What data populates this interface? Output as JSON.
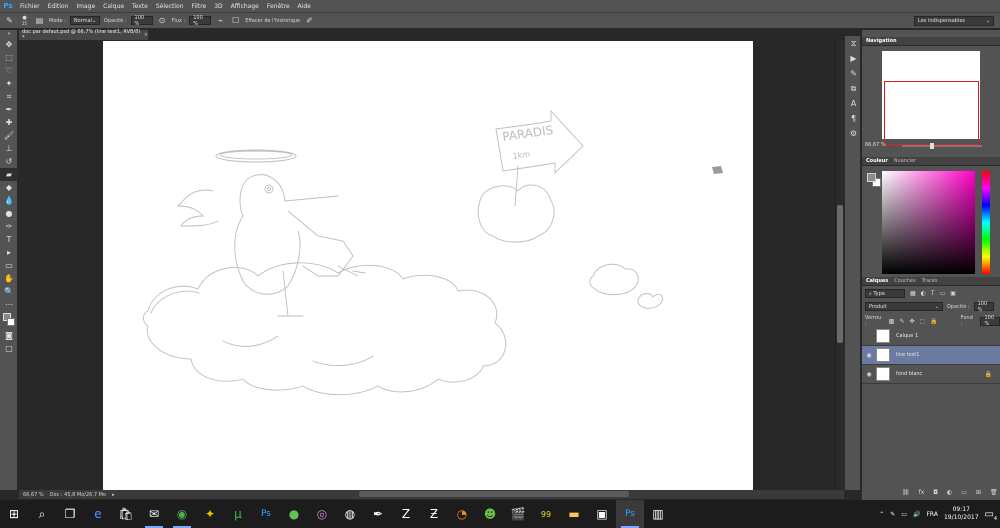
{
  "app": {
    "logo": "Ps"
  },
  "menu": [
    "Fichier",
    "Edition",
    "Image",
    "Calque",
    "Texte",
    "Sélection",
    "Filtre",
    "3D",
    "Affichage",
    "Fenêtre",
    "Aide"
  ],
  "options": {
    "brush_size": "25",
    "mode_label": "Mode :",
    "mode_value": "Normal",
    "opacity_label": "Opacité :",
    "opacity_value": "100 %",
    "flow_label": "Flux :",
    "flow_value": "100 %",
    "erase_history": "Effacer de l'historique",
    "workspace": "Les indispensables"
  },
  "document": {
    "tab_title": "doc par defaut.psd @ 66,7% (line test1, RVB/8) *",
    "close": "×"
  },
  "status": {
    "zoom": "66,67 %",
    "doc_info": "Doc : 45,8 Mo/26,7 Mo",
    "arrow": "▸"
  },
  "navigator": {
    "title": "Navigation",
    "zoom": "66,67 %"
  },
  "color_panel": {
    "tabs": [
      "Couleur",
      "Nuancier"
    ],
    "foreground": "#8a8a8a",
    "background": "#ffffff"
  },
  "layers_panel": {
    "tabs": [
      "Calques",
      "Couches",
      "Tracés"
    ],
    "filter": "Type",
    "blend_mode": "Produit",
    "opacity_label": "Opacité :",
    "opacity_value": "100 %",
    "lock_label": "Verrou :",
    "fill_label": "Fond :",
    "fill_value": "100 %",
    "layers": [
      {
        "name": "Calque 1",
        "visible": false,
        "selected": false,
        "locked": false
      },
      {
        "name": "line test1",
        "visible": true,
        "selected": true,
        "locked": false
      },
      {
        "name": "fond blanc",
        "visible": true,
        "selected": false,
        "locked": true
      }
    ]
  },
  "taskbar": {
    "language": "FRA",
    "time": "09:17",
    "date": "19/10/2017",
    "notification_count": "4"
  },
  "canvas_text": {
    "sign_line1": "PARADIS",
    "sign_line2": "1km"
  },
  "colors": {
    "accent_ps": "#31a8ff",
    "selected_layer": "#6b7aa0",
    "nav_view_rect": "#e02020"
  }
}
